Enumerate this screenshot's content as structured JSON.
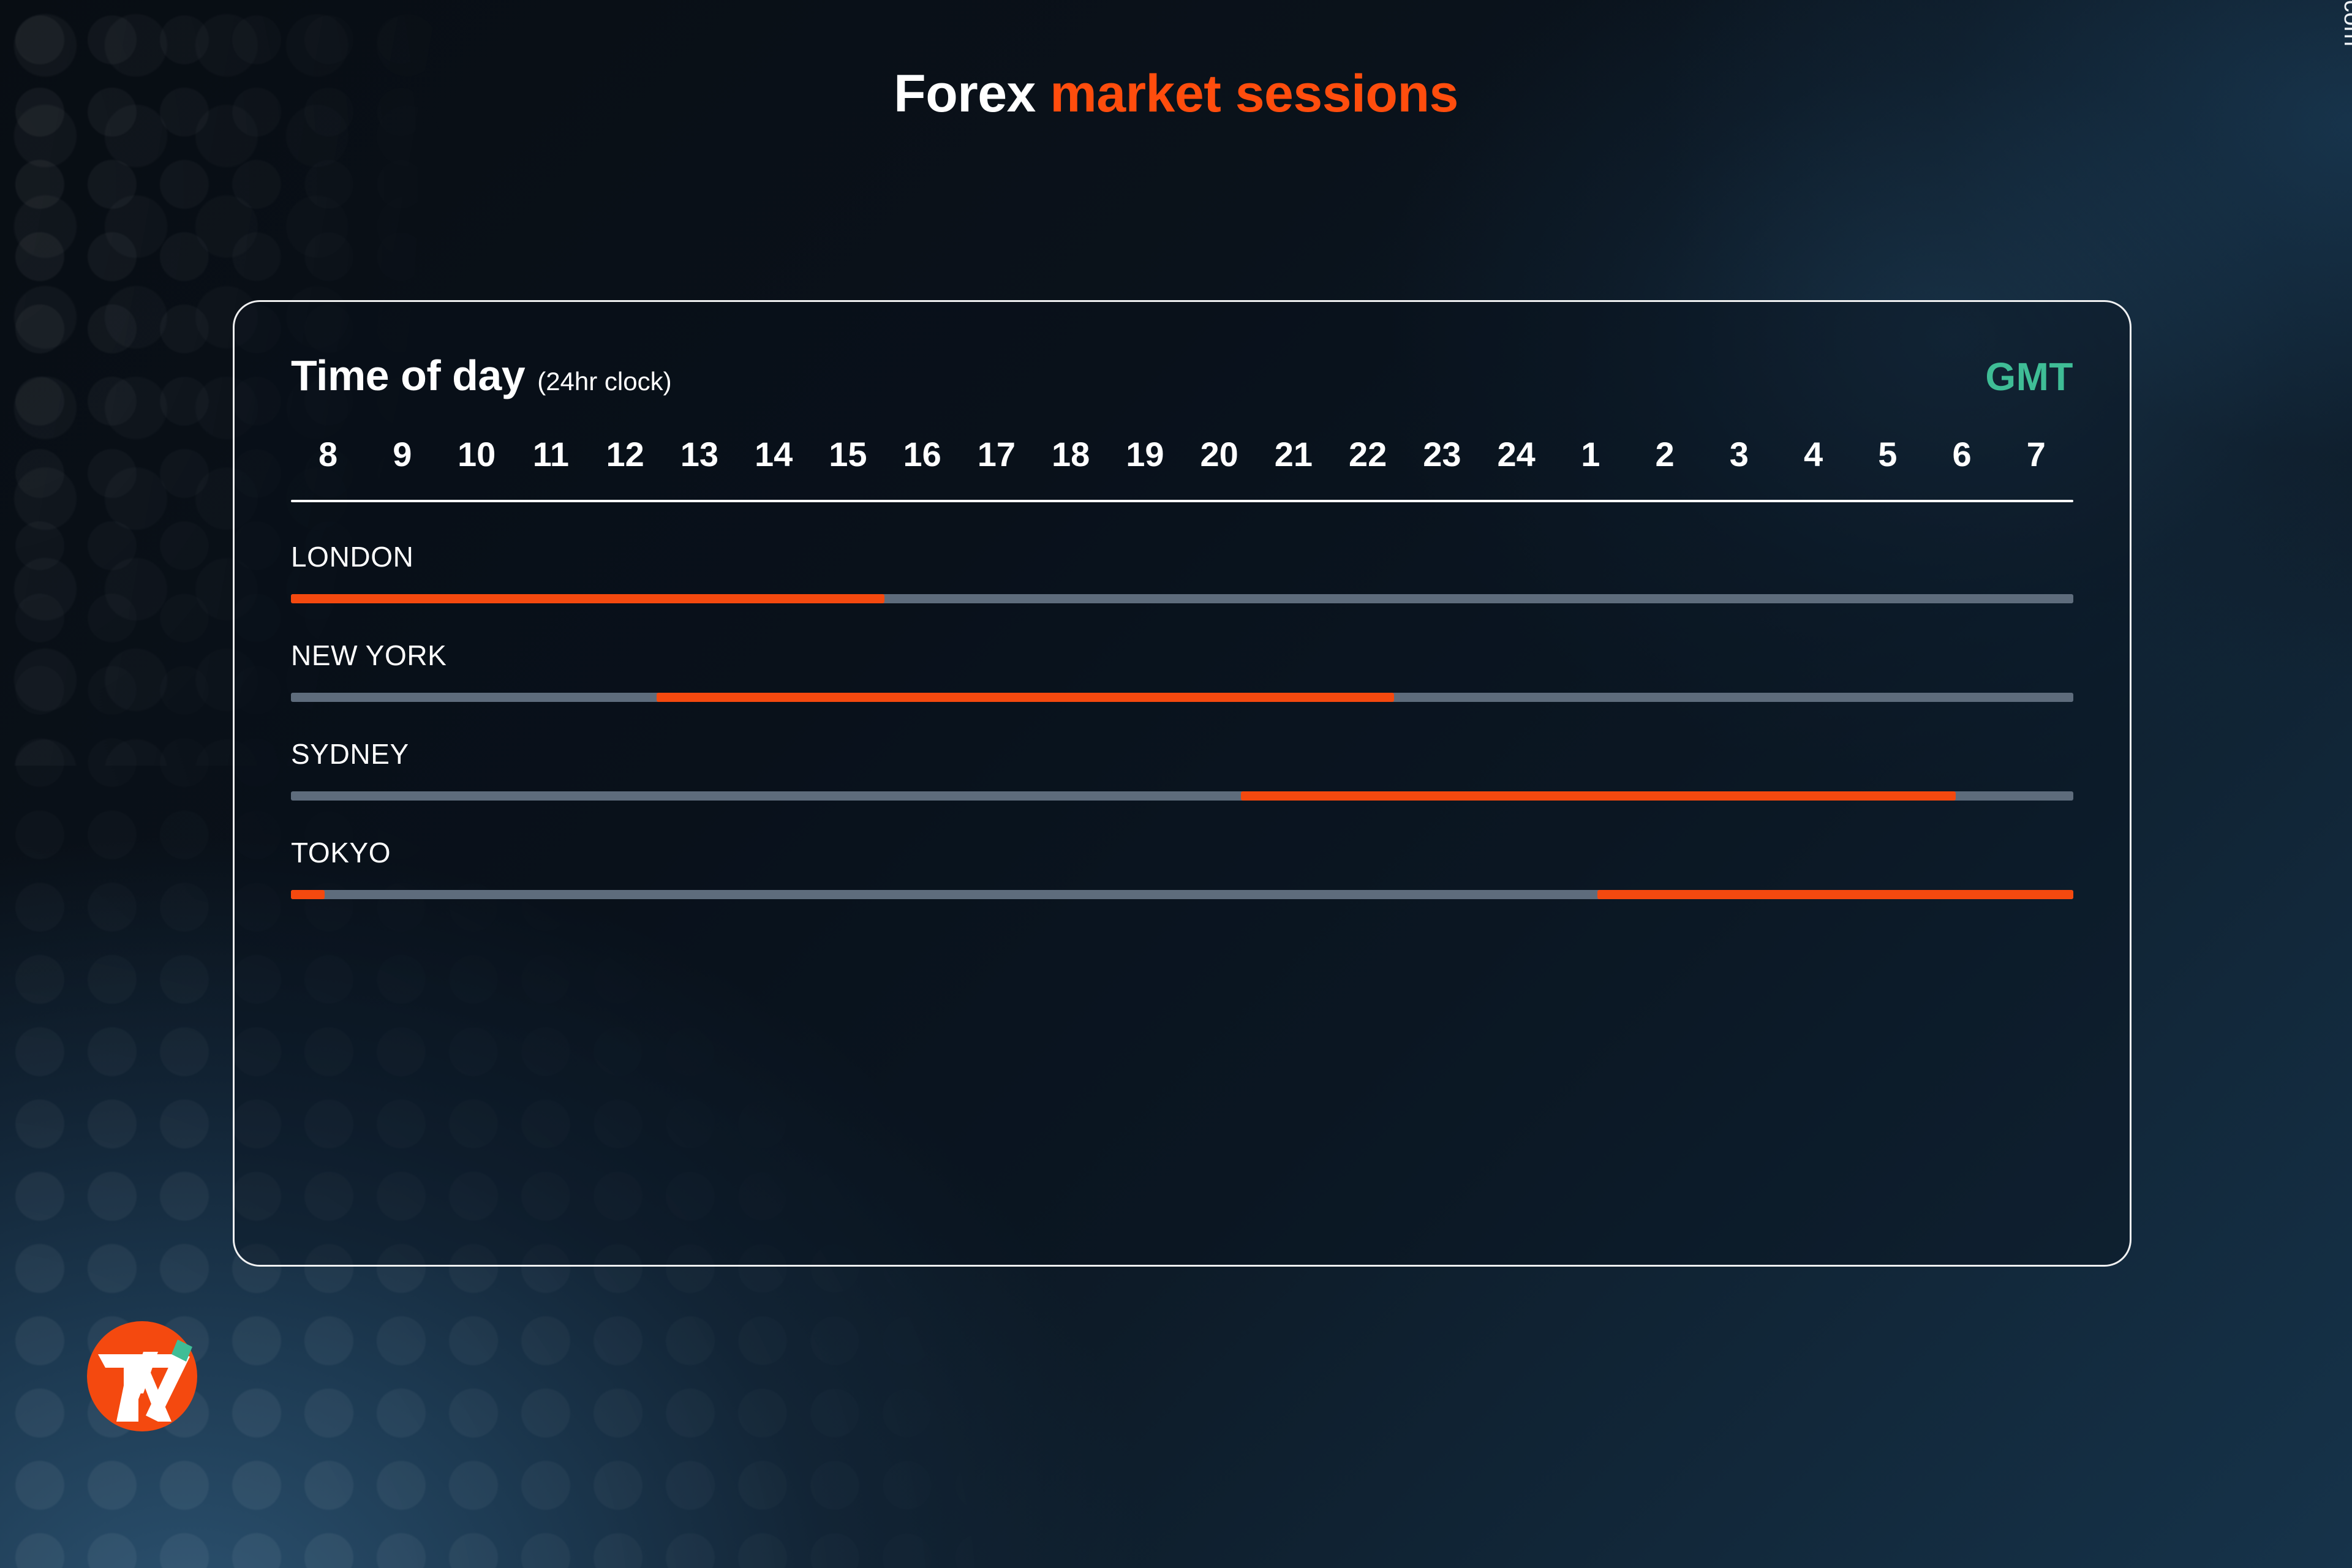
{
  "brand": {
    "site_url": "tradenation.com",
    "logo_name": "tradenation-logo",
    "accent_orange": "#ff4d0d",
    "accent_teal": "#3fbd96"
  },
  "title": {
    "part_white": "Forex",
    "part_orange": "market sessions"
  },
  "card": {
    "heading": "Time of day",
    "heading_note": "(24hr clock)",
    "timezone": "GMT"
  },
  "chart_data": {
    "type": "bar",
    "title": "Forex market sessions",
    "subtitle": "Time of day (24hr clock)",
    "xlabel": "GMT hour",
    "ylabel": "",
    "grid": false,
    "legend": false,
    "axis_start_hour": 8,
    "axis_end_hour": 8,
    "hours": [
      "8",
      "9",
      "10",
      "11",
      "12",
      "13",
      "14",
      "15",
      "16",
      "17",
      "18",
      "19",
      "20",
      "21",
      "22",
      "23",
      "24",
      "1",
      "2",
      "3",
      "4",
      "5",
      "6",
      "7"
    ],
    "track_color": "#5e6c7c",
    "active_color": "#f4490f",
    "categories": [
      "LONDON",
      "NEW YORK",
      "SYDNEY",
      "TOKYO"
    ],
    "series": [
      {
        "name": "LONDON",
        "open_hour": 8,
        "close_hour": 16,
        "segments": [
          {
            "start_pct": 0.0,
            "end_pct": 33.3
          }
        ]
      },
      {
        "name": "NEW YORK",
        "open_hour": 13,
        "close_hour": 22,
        "segments": [
          {
            "start_pct": 20.5,
            "end_pct": 61.9
          }
        ]
      },
      {
        "name": "SYDNEY",
        "open_hour": 21,
        "close_hour": 5,
        "segments": [
          {
            "start_pct": 53.3,
            "end_pct": 93.4
          }
        ]
      },
      {
        "name": "TOKYO",
        "open_hour": 24,
        "close_hour": 8,
        "segments": [
          {
            "start_pct": 0.0,
            "end_pct": 1.9
          },
          {
            "start_pct": 73.3,
            "end_pct": 100.0
          }
        ]
      }
    ]
  }
}
